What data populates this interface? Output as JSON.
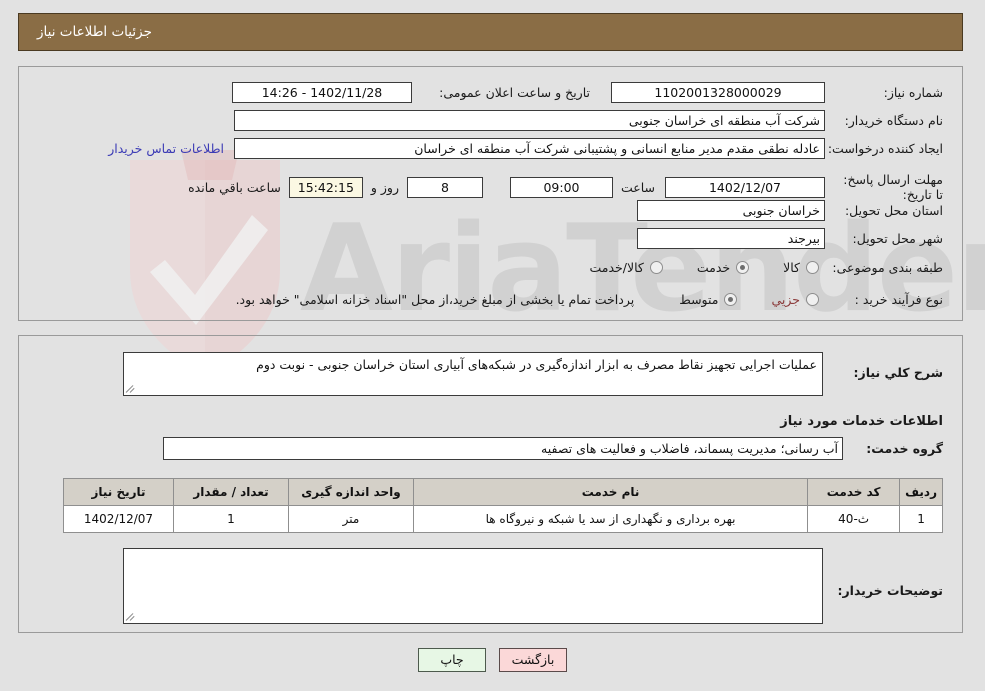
{
  "header": {
    "title": "جزئیات اطلاعات نیاز",
    "bg_color": "#8a6d45"
  },
  "watermark": {
    "text": "AriaTender.net"
  },
  "top_panel": {
    "need_number": {
      "label": "شماره نیاز:",
      "value": "1102001328000029"
    },
    "announce_datetime": {
      "label": "تاریخ و ساعت اعلان عمومی:",
      "value": "1402/11/28 - 14:26"
    },
    "buyer_org": {
      "label": "نام دستگاه خریدار:",
      "value": "شرکت آب منطقه ای خراسان جنوبی"
    },
    "request_creator": {
      "label": "ایجاد کننده درخواست:",
      "value": "عادله نطقی مقدم مدیر منابع انسانی و پشتیبانی شرکت آب منطقه ای خراسان",
      "contact_link": "اطلاعات تماس خریدار"
    },
    "response_deadline": {
      "label": "مهلت ارسال پاسخ: تا تاریخ:",
      "date": "1402/12/07",
      "hour_label": "ساعت",
      "hour": "09:00",
      "days": "8",
      "days_label": "روز و",
      "countdown": "15:42:15",
      "countdown_label": "ساعت باقي مانده"
    },
    "delivery_province": {
      "label": "استان محل تحویل:",
      "value": "خراسان جنوبی"
    },
    "delivery_city": {
      "label": "شهر محل تحویل:",
      "value": "بیرجند"
    },
    "subject_category": {
      "label": "طبقه بندی موضوعی:",
      "options": [
        {
          "label": "کالا",
          "selected": false
        },
        {
          "label": "خدمت",
          "selected": true
        },
        {
          "label": "کالا/خدمت",
          "selected": false
        }
      ]
    },
    "purchase_process": {
      "label": "نوع فرآیند خرید :",
      "options": [
        {
          "label": "جزیي",
          "selected": false
        },
        {
          "label": "متوسط",
          "selected": true
        }
      ],
      "note": "پرداخت تمام یا بخشی از مبلغ خرید،از محل \"اسناد خزانه اسلامی\" خواهد بود."
    }
  },
  "mid_panel": {
    "general_description": {
      "label": "شرح کلي نیاز:",
      "value": "عملیات اجرایی تجهیز نقاط مصرف به ابزار اندازه‌گیری در شبکه‌های آبیاری استان خراسان جنوبی - نوبت دوم"
    },
    "services_heading": "اطلاعات خدمات مورد نیاز",
    "service_group": {
      "label": "گروه خدمت:",
      "value": "آب رسانی؛ مدیریت پسماند، فاضلاب و فعالیت های تصفیه"
    },
    "table": {
      "columns": [
        "ردیف",
        "کد خدمت",
        "نام خدمت",
        "واحد اندازه گیری",
        "تعداد / مقدار",
        "تاریخ نیاز"
      ],
      "rows": [
        {
          "row": "1",
          "code": "ث-40",
          "name": "بهره برداری و نگهداری از سد یا شبکه و نیروگاه ها",
          "unit": "متر",
          "qty": "1",
          "date": "1402/12/07"
        }
      ]
    },
    "buyer_notes": {
      "label": "توضیحات خریدار:",
      "value": ""
    }
  },
  "footer": {
    "print_label": "چاپ",
    "back_label": "بازگشت"
  }
}
